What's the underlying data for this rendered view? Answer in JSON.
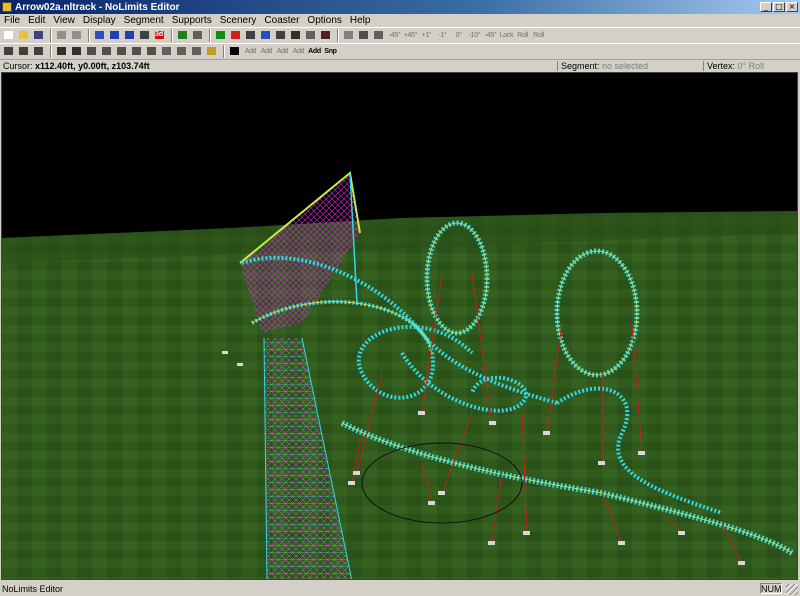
{
  "window": {
    "title": "Arrow02a.nltrack - NoLimits Editor"
  },
  "menu": [
    "File",
    "Edit",
    "View",
    "Display",
    "Segment",
    "Supports",
    "Scenery",
    "Coaster",
    "Options",
    "Help"
  ],
  "toolbar1": {
    "buttons": [
      {
        "name": "new-file-icon",
        "color": "#ffffff"
      },
      {
        "name": "open-folder-icon",
        "color": "#e8c040"
      },
      {
        "name": "save-disk-icon",
        "color": "#404080"
      },
      {
        "sep": true
      },
      {
        "name": "undo-icon",
        "color": "#909090"
      },
      {
        "name": "redo-icon",
        "color": "#909090"
      },
      {
        "sep": true
      },
      {
        "name": "track-grid-icon",
        "color": "#3050c0"
      },
      {
        "name": "valley-icon",
        "color": "#2040b0"
      },
      {
        "name": "hill-icon",
        "color": "#2040b0"
      },
      {
        "name": "coaster-train-icon",
        "color": "#404040"
      },
      {
        "name": "3d-view-icon",
        "color": "#d01010",
        "text": "3d"
      },
      {
        "sep": true
      },
      {
        "name": "add-segment-icon",
        "color": "#208020"
      },
      {
        "name": "remove-segment-icon",
        "color": "#606060"
      },
      {
        "sep": true
      },
      {
        "name": "terrain-grid-icon",
        "color": "#109010"
      },
      {
        "name": "traffic-light-icon",
        "color": "#d02020"
      },
      {
        "name": "station-icon",
        "color": "#404040"
      },
      {
        "name": "pyramid-icon",
        "color": "#2050c0"
      },
      {
        "name": "ruler-icon",
        "color": "#404040"
      },
      {
        "name": "node-path-icon",
        "color": "#303030"
      },
      {
        "name": "list-icon",
        "color": "#606060"
      },
      {
        "name": "properties-icon",
        "color": "#502020"
      },
      {
        "sep": true
      },
      {
        "name": "view-split-icon",
        "color": "#808080"
      },
      {
        "name": "view-full-icon",
        "color": "#505050"
      },
      {
        "name": "align-icon",
        "color": "#606060"
      }
    ],
    "labels": [
      "-45°",
      "+45°",
      "+1°",
      "-1°",
      "0°",
      "-10°",
      "-45°",
      "Lock",
      "Roll",
      "Roll"
    ]
  },
  "toolbar2": {
    "buttons": [
      {
        "name": "vertex-edit-icon",
        "color": "#404040"
      },
      {
        "name": "vertex-move-icon",
        "color": "#404040"
      },
      {
        "name": "vertex-rotate-icon",
        "color": "#404040"
      },
      {
        "sep": true
      },
      {
        "name": "pencil-icon",
        "color": "#303030"
      },
      {
        "name": "pen-icon",
        "color": "#303030"
      },
      {
        "name": "support-column-icon",
        "color": "#505050"
      },
      {
        "name": "support-cylinder-icon",
        "color": "#505050"
      },
      {
        "name": "support-round-icon",
        "color": "#505050"
      },
      {
        "name": "support-box-icon",
        "color": "#505050"
      },
      {
        "name": "support-stack-icon",
        "color": "#505050"
      },
      {
        "name": "footer-icon",
        "color": "#606060"
      },
      {
        "name": "ramp-icon",
        "color": "#606060"
      },
      {
        "name": "tunnel-icon",
        "color": "#606060"
      },
      {
        "name": "color-palette-icon",
        "color": "#c0a020"
      },
      {
        "sep": true
      },
      {
        "name": "select-arrow-icon",
        "color": "#000000"
      }
    ],
    "labels": [
      "Add",
      "Add",
      "Add",
      "Add",
      "Add",
      "Snp"
    ]
  },
  "status_top": {
    "cursor_label": "Cursor:",
    "cursor_value": "x112.40ft, y0.00ft, z103.74ft",
    "segment_label": "Segment:",
    "segment_value": "no selected",
    "vertex_label": "Vertex:",
    "vertex_value": "0° Roll"
  },
  "statusbar": {
    "message": "NoLimits Editor",
    "num": "NUM"
  },
  "colors": {
    "sky": "#000000",
    "grass": "#2f5a1c",
    "track": "#30d8e8",
    "lift_structure": "#e020e0",
    "supports": "#c02020",
    "spine": "#e8e040"
  }
}
